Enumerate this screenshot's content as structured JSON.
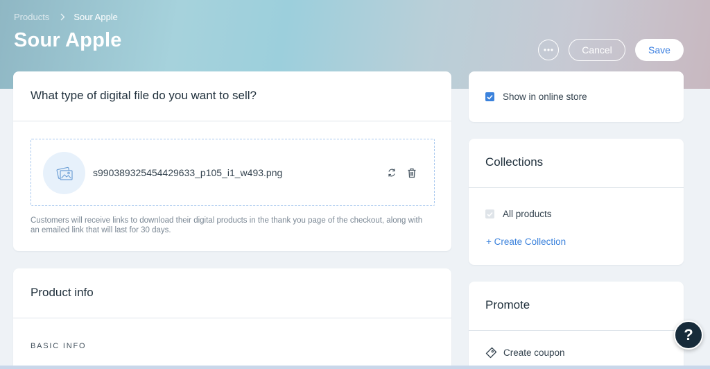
{
  "breadcrumb": {
    "parent": "Products",
    "current": "Sour Apple"
  },
  "page_title": "Sour Apple",
  "actions": {
    "more_icon": "ellipsis-icon",
    "cancel": "Cancel",
    "save": "Save"
  },
  "digital_file": {
    "title": "What type of digital file do you want to sell?",
    "file_name": "s990389325454429633_p105_i1_w493.png",
    "thumb_icon": "image-icon",
    "replace_icon": "replace-icon",
    "delete_icon": "trash-icon",
    "helper_text": "Customers will receive links to download their digital products in the thank you page of the checkout, along with an emailed link that will last for 30 days."
  },
  "product_info": {
    "title": "Product info",
    "section": "BASIC INFO"
  },
  "store": {
    "label": "Show in online store",
    "checked": true
  },
  "collections": {
    "title": "Collections",
    "items": [
      {
        "label": "All products",
        "checked": true,
        "disabled": true
      }
    ],
    "create_link": "+ Create Collection"
  },
  "promote": {
    "title": "Promote",
    "coupon_label": "Create coupon",
    "coupon_icon": "ticket-icon"
  },
  "help": {
    "label": "?"
  },
  "colors": {
    "accent": "#3b82dc",
    "dark": "#172b3a"
  }
}
